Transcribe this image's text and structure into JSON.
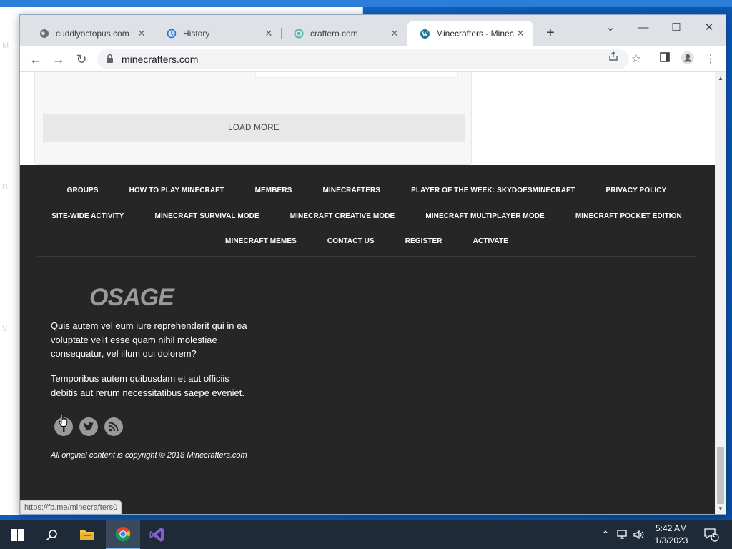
{
  "browser": {
    "tabs": [
      {
        "title": "cuddlyoctopus.com",
        "icon": "globe-icon"
      },
      {
        "title": "History",
        "icon": "history-icon"
      },
      {
        "title": "craftero.com",
        "icon": "craftero-icon"
      },
      {
        "title": "Minecrafters - Minec",
        "icon": "wordpress-icon",
        "active": true
      }
    ],
    "url": "minecrafters.com"
  },
  "page": {
    "load_more": "LOAD MORE",
    "footer_menu": {
      "row1": [
        "GROUPS",
        "HOW TO PLAY MINECRAFT",
        "MEMBERS",
        "MINECRAFTERS",
        "PLAYER OF THE WEEK: SKYDOESMINECRAFT",
        "PRIVACY POLICY"
      ],
      "row2": [
        "SITE-WIDE ACTIVITY",
        "MINECRAFT SURVIVAL MODE",
        "MINECRAFT CREATIVE MODE",
        "MINECRAFT MULTIPLAYER MODE",
        "MINECRAFT POCKET EDITION"
      ],
      "row3": [
        "MINECRAFT MEMES",
        "CONTACT US",
        "REGISTER",
        "ACTIVATE"
      ]
    },
    "logo": "OSAGE",
    "paragraph1": "Quis autem vel eum iure reprehenderit qui in ea voluptate velit esse quam nihil molestiae consequatur, vel illum qui dolorem?",
    "paragraph2": "Temporibus autem quibusdam et aut officiis debitis aut rerum necessitatibus saepe eveniet.",
    "social": [
      "facebook-icon",
      "twitter-icon",
      "rss-icon"
    ],
    "copyright": "All original content is copyright © 2018 Minecrafters.com",
    "status_url": "https://fb.me/minecrafters0"
  },
  "taskbar": {
    "time": "5:42 AM",
    "date": "1/3/2023",
    "notification_count": "1"
  },
  "desktop_letters": [
    "M",
    "D",
    "V"
  ]
}
